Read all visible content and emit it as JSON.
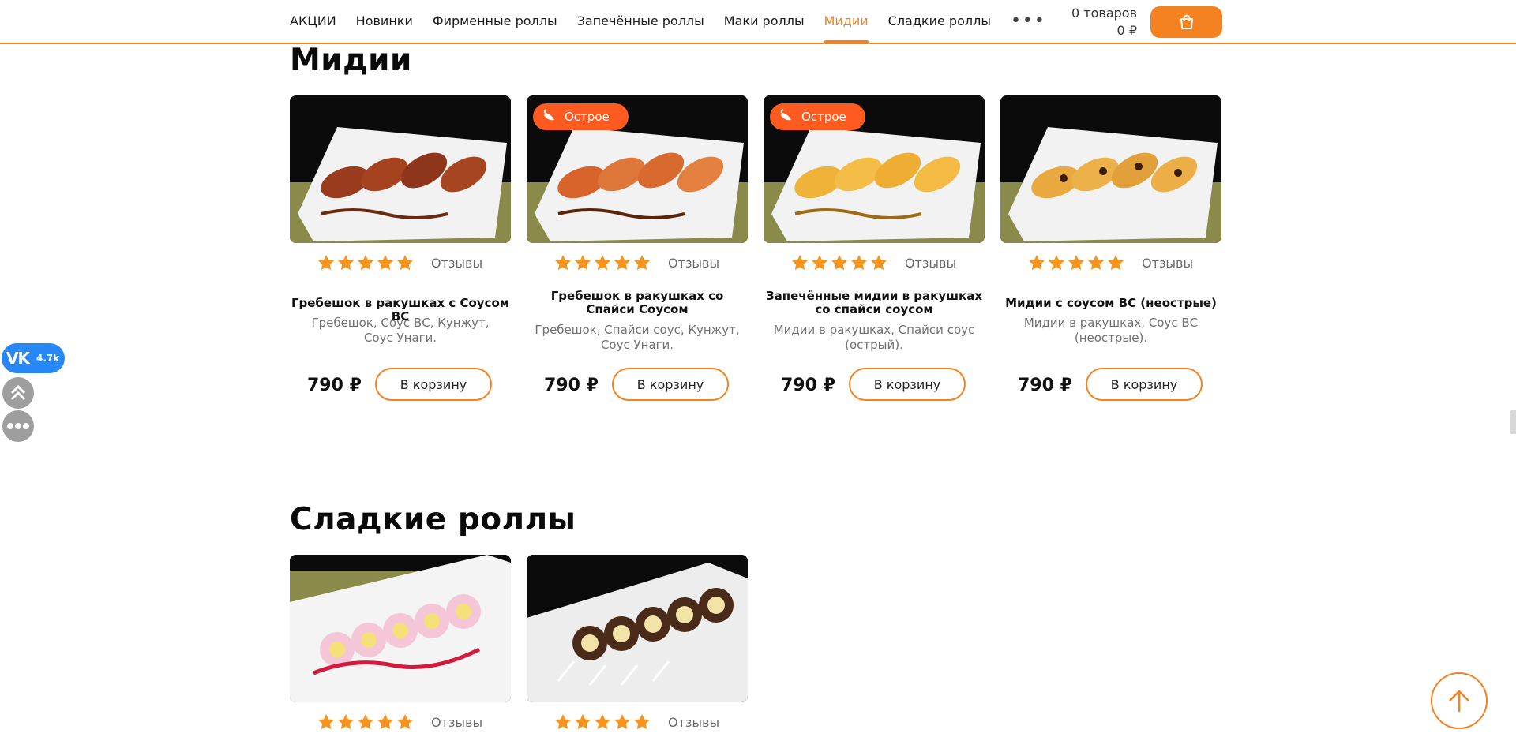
{
  "nav": {
    "items": [
      "АКЦИИ",
      "Новинки",
      "Фирменные роллы",
      "Запечённые роллы",
      "Маки роллы",
      "Мидии",
      "Сладкие роллы"
    ],
    "active_index": 5,
    "more_icon": "more-dots-icon"
  },
  "cart": {
    "count_text": "0 товаров",
    "total_text": "0 ₽",
    "icon": "shopping-bag-icon"
  },
  "colors": {
    "accent": "#f58220",
    "spicy_badge": "#ff5a1f",
    "star": "#f7941d",
    "vk": "#2787f5"
  },
  "sections": [
    {
      "title": "Мидии",
      "products": [
        {
          "name": "Гребешок в ракушках с Соусом ВС",
          "description": "Гребешок, Соус ВС, Кунжут, Соус Унаги.",
          "price": "790 ₽",
          "button": "В корзину",
          "reviews": "Отзывы",
          "rating": 5,
          "badge": ""
        },
        {
          "name": "Гребешок в ракушках со Спайси Соусом",
          "description": "Гребешок, Спайси соус, Кунжут, Соус Унаги.",
          "price": "790 ₽",
          "button": "В корзину",
          "reviews": "Отзывы",
          "rating": 5,
          "badge": "Острое"
        },
        {
          "name": "Запечённые мидии в ракушках со спайси соусом",
          "description": "Мидии в ракушках, Спайси соус (острый).",
          "price": "790 ₽",
          "button": "В корзину",
          "reviews": "Отзывы",
          "rating": 5,
          "badge": "Острое"
        },
        {
          "name": "Мидии с соусом ВС (неострые)",
          "description": "Мидии в ракушках, Соус ВС (неострые).",
          "price": "790 ₽",
          "button": "В корзину",
          "reviews": "Отзывы",
          "rating": 5,
          "badge": ""
        }
      ]
    },
    {
      "title": "Сладкие роллы",
      "products": [
        {
          "reviews": "Отзывы",
          "rating": 5
        },
        {
          "reviews": "Отзывы",
          "rating": 5
        }
      ]
    }
  ],
  "widgets": {
    "vk_label": "VK",
    "vk_count": "4.7k"
  }
}
